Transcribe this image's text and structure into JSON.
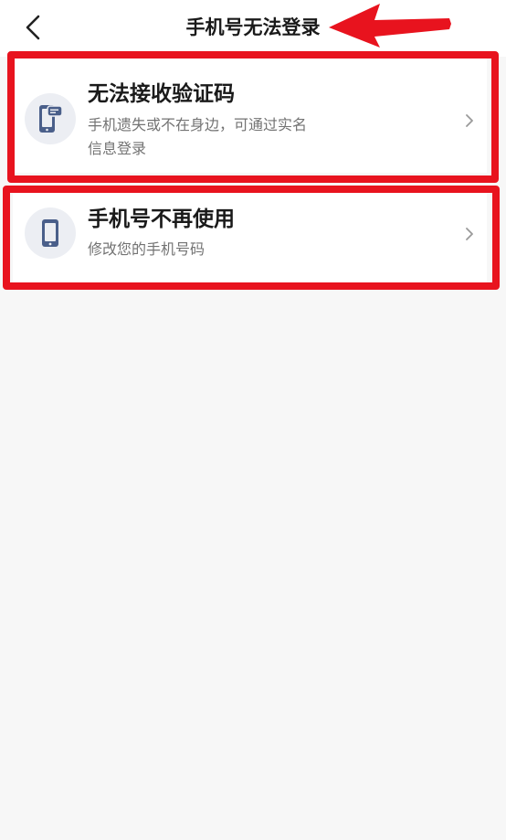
{
  "header": {
    "title": "手机号无法登录",
    "back_icon": "chevron-left-icon"
  },
  "options": [
    {
      "title": "无法接收验证码",
      "description_line1": "手机遗失或不在身边，可通过实名",
      "description_line2": "信息登录",
      "icon": "phone-message-icon"
    },
    {
      "title": "手机号不再使用",
      "description": "修改您的手机号码",
      "icon": "mobile-phone-icon"
    }
  ],
  "colors": {
    "icon_blue": "#4a5f8a",
    "annotation_red": "#e8131e",
    "page_background": "#f7f7f7"
  }
}
